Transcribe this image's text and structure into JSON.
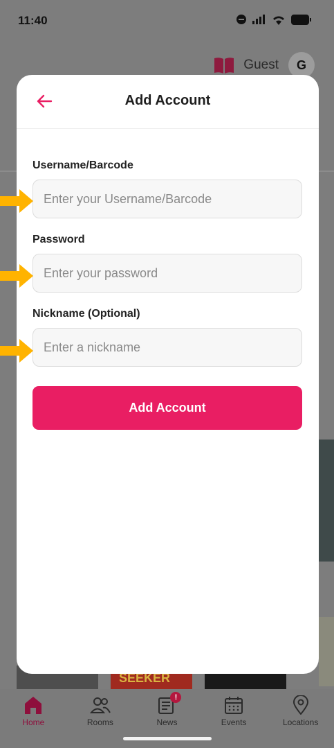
{
  "status_bar": {
    "time": "11:40"
  },
  "header": {
    "guest_name": "Guest",
    "avatar_initial": "G"
  },
  "modal": {
    "title": "Add Account",
    "fields": [
      {
        "label": "Username/Barcode",
        "placeholder": "Enter your Username/Barcode",
        "value": ""
      },
      {
        "label": "Password",
        "placeholder": "Enter your password",
        "value": ""
      },
      {
        "label": "Nickname (Optional)",
        "placeholder": "Enter a nickname",
        "value": ""
      }
    ],
    "submit_label": "Add Account"
  },
  "background_books": {
    "seeker_label": "SEEKER"
  },
  "tab_bar": {
    "tabs": [
      {
        "label": "Home",
        "icon": "home-icon",
        "active": true
      },
      {
        "label": "Rooms",
        "icon": "people-icon",
        "active": false
      },
      {
        "label": "News",
        "icon": "newspaper-icon",
        "active": false,
        "badge": "!"
      },
      {
        "label": "Events",
        "icon": "calendar-icon",
        "active": false
      },
      {
        "label": "Locations",
        "icon": "location-pin-icon",
        "active": false
      }
    ]
  },
  "colors": {
    "accent": "#e91e63",
    "arrow": "#ffb300",
    "dim_background": "#7d7d7d"
  }
}
